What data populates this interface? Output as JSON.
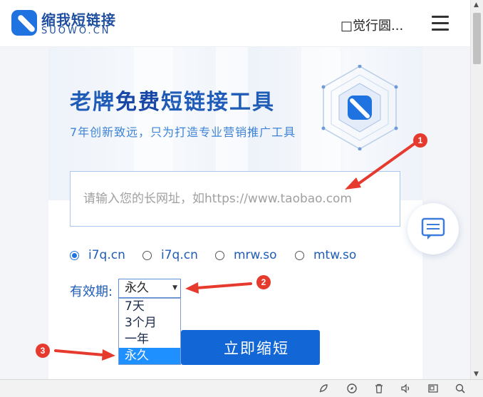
{
  "header": {
    "logo_cn": "缩我短链接",
    "logo_en": "SUOWO.CN",
    "link_text": "□觉行圆..."
  },
  "hero": {
    "title_part1": "老牌",
    "title_accent": "免费",
    "title_part2": "短链接工具",
    "subtitle": "7年创新致远，只为打造专业营销推广工具"
  },
  "form": {
    "url_placeholder": "请输入您的长网址，如https://www.taobao.com",
    "domains": [
      {
        "label": "i7q.cn",
        "selected": true
      },
      {
        "label": "i7q.cn",
        "selected": false
      },
      {
        "label": "mrw.so",
        "selected": false
      },
      {
        "label": "mtw.so",
        "selected": false
      }
    ],
    "expiry_label": "有效期:",
    "expiry_value": "永久",
    "expiry_options": [
      "7天",
      "3个月",
      "一年",
      "永久"
    ],
    "submit_label": "立即缩短"
  },
  "annotations": {
    "badge1": "1",
    "badge2": "2",
    "badge3": "3"
  },
  "icons": [
    "shortlink-logo-icon",
    "menu-icon",
    "chat-icon",
    "rocket-icon",
    "compass-icon",
    "trash-icon",
    "speaker-icon",
    "window-icon",
    "search-icon"
  ],
  "colors": {
    "brand": "#1f73e0",
    "title": "#1f5cb8",
    "button": "#1266d6",
    "annotation": "#e63a2e",
    "selected_option": "#1e90ff"
  }
}
